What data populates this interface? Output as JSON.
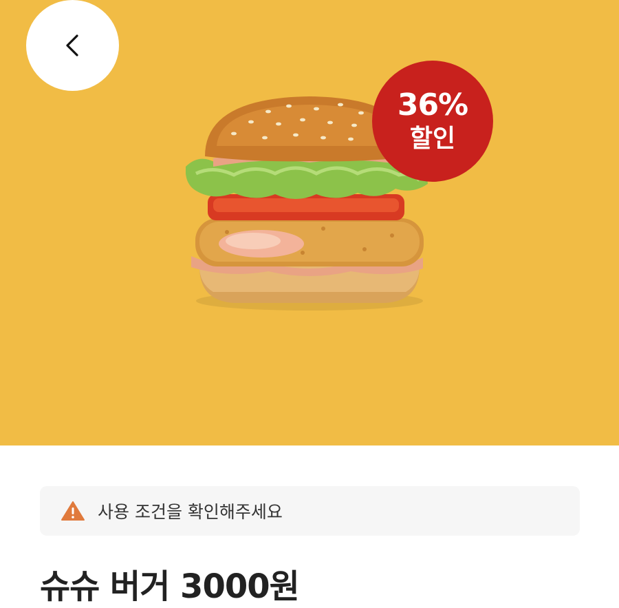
{
  "colors": {
    "hero_background": "#f1bc45",
    "badge_background": "#c8211d",
    "warning_icon": "#e07a3c",
    "title_text": "#222222"
  },
  "header": {
    "back_icon": "chevron-left-icon"
  },
  "hero": {
    "image": "shrimp-burger",
    "discount_badge": {
      "percent": "36%",
      "label": "할인"
    }
  },
  "notice": {
    "icon": "warning-icon",
    "text": "사용 조건을 확인해주세요"
  },
  "product": {
    "title": "슈슈 버거 3000원"
  }
}
